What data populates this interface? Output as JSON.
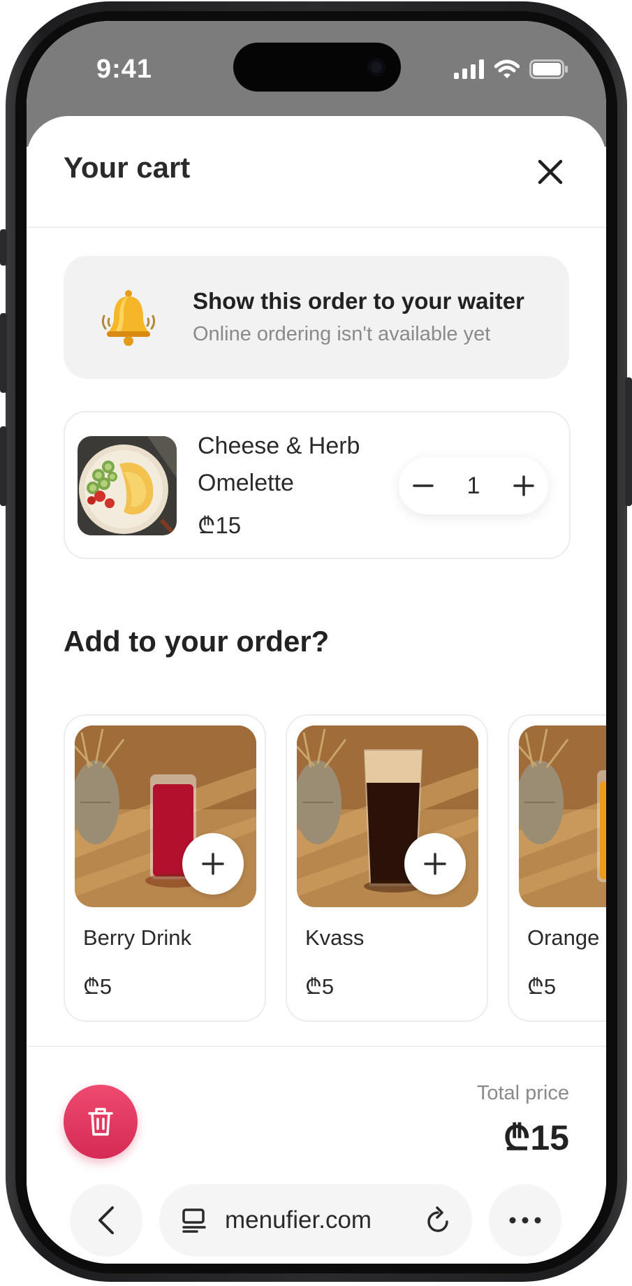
{
  "status_bar": {
    "time": "9:41"
  },
  "cart": {
    "title": "Your cart",
    "notice": {
      "title": "Show this order to your waiter",
      "subtitle": "Online ordering isn't available yet",
      "icon": "bell-icon"
    },
    "items": [
      {
        "name": "Cheese & Herb Omelette",
        "price": "₾15",
        "quantity": "1"
      }
    ]
  },
  "upsell": {
    "title": "Add to your order?",
    "items": [
      {
        "name": "Berry Drink",
        "price": "₾5",
        "drink_color": "#b3102e"
      },
      {
        "name": "Kvass",
        "price": "₾5",
        "drink_color": "#2a1208"
      },
      {
        "name": "Orange",
        "price": "₾5",
        "drink_color": "#f09a1a"
      }
    ]
  },
  "footer": {
    "total_label": "Total price",
    "total_value": "₾15"
  },
  "browser": {
    "url": "menufier.com"
  },
  "colors": {
    "accent_delete": "#e0385f",
    "text_primary": "#222222",
    "text_secondary": "#8a8a8a"
  }
}
